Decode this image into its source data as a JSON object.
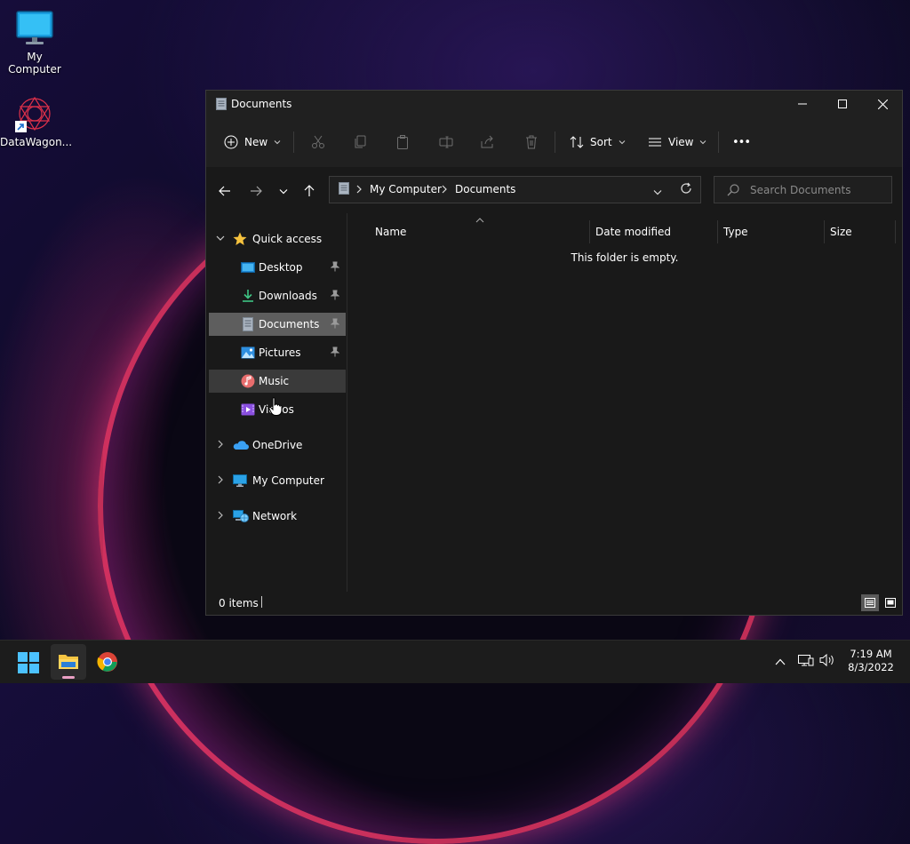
{
  "desktop": {
    "icons": [
      {
        "label": "My Computer",
        "icon": "monitor-icon"
      },
      {
        "label": "DataWagon...",
        "icon": "datawagon-shortcut-icon"
      }
    ]
  },
  "window": {
    "title": "Documents",
    "toolbar": {
      "new_label": "New",
      "sort_label": "Sort",
      "view_label": "View",
      "more_label": "•••"
    },
    "address": {
      "breadcrumb": [
        "My Computer",
        "Documents"
      ]
    },
    "search": {
      "placeholder": "Search Documents"
    },
    "nav": {
      "quick_access": "Quick access",
      "items": [
        {
          "label": "Desktop",
          "icon": "desktop-folder-icon",
          "pinned": true
        },
        {
          "label": "Downloads",
          "icon": "downloads-folder-icon",
          "pinned": true
        },
        {
          "label": "Documents",
          "icon": "documents-folder-icon",
          "pinned": true,
          "selected": true
        },
        {
          "label": "Pictures",
          "icon": "pictures-folder-icon",
          "pinned": true
        },
        {
          "label": "Music",
          "icon": "music-folder-icon",
          "pinned": false,
          "hover": true
        },
        {
          "label": "Videos",
          "icon": "videos-folder-icon",
          "pinned": false
        }
      ],
      "onedrive": "OneDrive",
      "my_computer": "My Computer",
      "network": "Network"
    },
    "columns": [
      "Name",
      "Date modified",
      "Type",
      "Size"
    ],
    "empty_message": "This folder is empty.",
    "status": {
      "items_count": "0 items"
    }
  },
  "taskbar": {
    "apps": [
      {
        "name": "start",
        "icon": "windows-start-icon"
      },
      {
        "name": "file-explorer",
        "icon": "file-explorer-icon",
        "active": true
      },
      {
        "name": "chrome",
        "icon": "chrome-icon"
      }
    ],
    "clock": {
      "time": "7:19 AM",
      "date": "8/3/2022"
    }
  },
  "colors": {
    "window_bg": "#191919",
    "selected_item": "#5e5e5e",
    "hover_item": "#3a3a3a",
    "accent": "#0078d4"
  }
}
